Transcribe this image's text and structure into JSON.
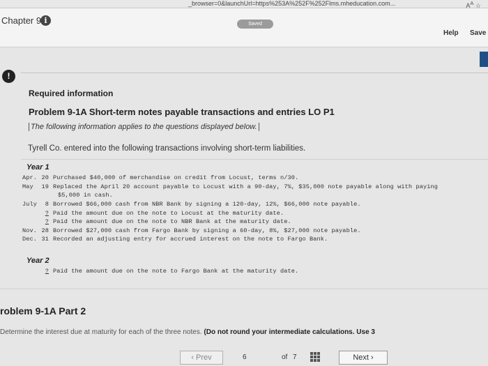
{
  "browser": {
    "address": "_browser=0&launchUrl=https%253A%252F%252Flms.mheducation.com..."
  },
  "header": {
    "chapter": "Chapter 9",
    "status": "Saved",
    "help": "Help",
    "save_exit": "Save &"
  },
  "problem": {
    "required_info": "Required information",
    "title": "Problem 9-1A Short-term notes payable transactions and entries LO P1",
    "note": "The following information applies to the questions displayed below.",
    "intro": "Tyrell Co. entered into the following transactions involving short-term liabilities."
  },
  "year1": {
    "label": "Year 1",
    "transactions": [
      {
        "month": "Apr.",
        "day": "20",
        "text": "Purchased $40,000 of merchandise on credit from Locust, terms n/30."
      },
      {
        "month": "May",
        "day": "19",
        "text": "Replaced the April 20 account payable to Locust with a 90-day, 7%, $35,000 note payable along with paying"
      },
      {
        "month": "",
        "day": "",
        "text": "$5,000 in cash."
      },
      {
        "month": "July",
        "day": "8",
        "text": "Borrowed $66,000 cash from NBR Bank by signing a 120-day, 12%, $66,000 note payable."
      },
      {
        "month": "",
        "day": "?",
        "text": "Paid the amount due on the note to Locust at the maturity date."
      },
      {
        "month": "",
        "day": "?",
        "text": "Paid the amount due on the note to NBR Bank at the maturity date."
      },
      {
        "month": "Nov.",
        "day": "28",
        "text": "Borrowed $27,000 cash from Fargo Bank by signing a 60-day, 8%, $27,000 note payable."
      },
      {
        "month": "Dec.",
        "day": "31",
        "text": "Recorded an adjusting entry for accrued interest on the note to Fargo Bank."
      }
    ]
  },
  "year2": {
    "label": "Year 2",
    "transactions": [
      {
        "month": "",
        "day": "?",
        "text": "Paid the amount due on the note to Fargo Bank at the maturity date."
      }
    ]
  },
  "part2": {
    "title": "roblem 9-1A Part 2",
    "instruction": "Determine the interest due at maturity for each of the three notes.",
    "instruction_bold": "(Do not round your intermediate calculations. Use 3"
  },
  "nav": {
    "prev": "Prev",
    "current_page": "6",
    "of": "of",
    "total_pages": "7",
    "next": "Next"
  }
}
